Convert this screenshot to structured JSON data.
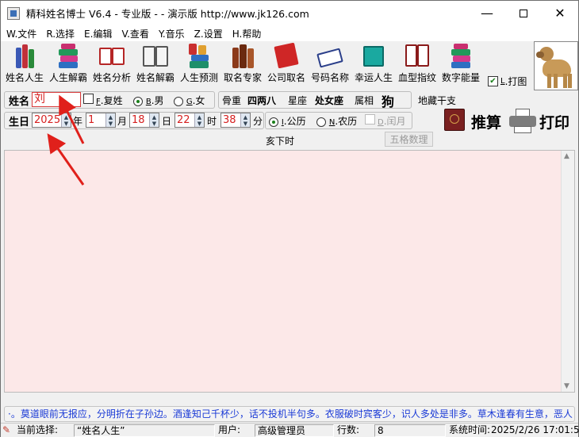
{
  "window": {
    "title": "精科姓名博士 V6.4 - 专业版 - - 演示版  http://www.jk126.com",
    "min_glyph": "—",
    "close_glyph": "✕"
  },
  "menu": [
    "W.文件",
    "R.选择",
    "E.编辑",
    "V.查看",
    "Y.音乐",
    "Z.设置",
    "H.帮助"
  ],
  "toolbar": {
    "tools": [
      {
        "label": "姓名人生",
        "icon": "books-icon"
      },
      {
        "label": "人生解霸",
        "icon": "books-stack-icon"
      },
      {
        "label": "姓名分析",
        "icon": "open-book-icon"
      },
      {
        "label": "姓名解霸",
        "icon": "open-book-gray-icon"
      },
      {
        "label": "人生预测",
        "icon": "books-stack-icon"
      },
      {
        "label": "取名专家",
        "icon": "books-icon"
      },
      {
        "label": "公司取名",
        "icon": "red-book-icon"
      },
      {
        "label": "号码名称",
        "icon": "open-book-icon"
      },
      {
        "label": "幸运人生",
        "icon": "teal-book-icon"
      },
      {
        "label": "血型指纹",
        "icon": "open-book-icon"
      },
      {
        "label": "数字能量",
        "icon": "books-stack-icon"
      }
    ],
    "print_photo": {
      "checked": true,
      "label_key": "L",
      "label": ".打图"
    }
  },
  "name_row": {
    "name_label": "姓名",
    "surname_value": "刘",
    "compound_key": "F",
    "compound_label": ".复姓",
    "male_key": "B",
    "male_label": ".男",
    "female_key": "G",
    "female_label": ".女",
    "gender_selected": "male",
    "bone_weight_label": "骨重",
    "bone_weight_value": "四两八",
    "constellation_label": "星座",
    "constellation_value": "处女座",
    "zodiac_label": "属相",
    "zodiac_value": "狗",
    "hidden_stems_label": "地藏干支"
  },
  "date_row": {
    "birthday_label": "生日",
    "year_value": "2025",
    "year_unit": "年",
    "month_value": "1",
    "month_unit": "月",
    "day_value": "18",
    "day_unit": "日",
    "hour_value": "22",
    "hour_unit": "时",
    "minute_value": "38",
    "minute_unit": "分",
    "solar_key": "I",
    "solar_label": ".公历",
    "lunar_key": "N",
    "lunar_label": ".农历",
    "leap_key": "D",
    "leap_label": ".闰月",
    "calendar_selected": "solar",
    "calc_label": "推算",
    "print_label": "打印"
  },
  "info_row": {
    "hour_branch": "亥下时",
    "five_grid_button": "五格数理"
  },
  "ticker": {
    "text": "·。莫道眼前无报应，分明折在子孙边。酒逢知己千杯少，话不投机半句多。衣服破时宾客少，识人多处是非多。草木逢春有生意，恶人"
  },
  "status": {
    "current_label": "当前选择:",
    "current_value": "“姓名人生”",
    "user_label": "用户:",
    "user_value": "高级管理员",
    "count_label": "行数:",
    "count_value": "8",
    "time_label": "系统时间:",
    "time_value": "2025/2/26 17:01:5"
  },
  "colors": {
    "content_bg": "#fce8e8",
    "accent_red": "#d61f1f",
    "ticker_blue": "#1a3ad6",
    "annotation_red": "#e0201b"
  }
}
